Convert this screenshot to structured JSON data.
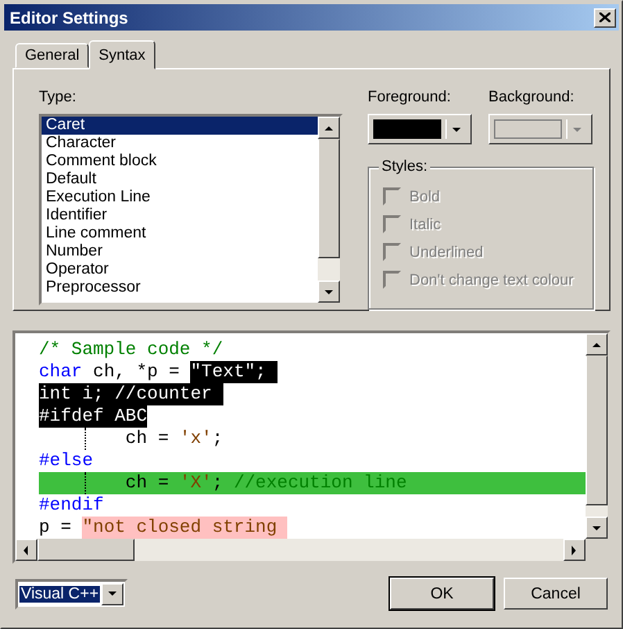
{
  "window": {
    "title": "Editor Settings"
  },
  "tabs": [
    {
      "label": "General",
      "selected": false
    },
    {
      "label": "Syntax",
      "selected": true
    }
  ],
  "type_list": {
    "label": "Type:",
    "items": [
      {
        "label": "Caret",
        "selected": true
      },
      {
        "label": "Character",
        "selected": false
      },
      {
        "label": "Comment block",
        "selected": false
      },
      {
        "label": "Default",
        "selected": false
      },
      {
        "label": "Execution Line",
        "selected": false
      },
      {
        "label": "Identifier",
        "selected": false
      },
      {
        "label": "Line comment",
        "selected": false
      },
      {
        "label": "Number",
        "selected": false
      },
      {
        "label": "Operator",
        "selected": false
      },
      {
        "label": "Preprocessor",
        "selected": false
      }
    ]
  },
  "foreground": {
    "label": "Foreground:",
    "color": "#000000",
    "disabled": false
  },
  "background": {
    "label": "Background:",
    "disabled": true
  },
  "styles": {
    "label": "Styles:",
    "options": [
      {
        "label": "Bold",
        "checked": false,
        "disabled": true
      },
      {
        "label": "Italic",
        "checked": false,
        "disabled": true
      },
      {
        "label": "Underlined",
        "checked": false,
        "disabled": true
      },
      {
        "label": "Don't change text colour",
        "checked": false,
        "disabled": true
      }
    ]
  },
  "code_lines": [
    {
      "kind": "normal",
      "indent_guide": false,
      "segments": [
        {
          "text": "/* Sample code */",
          "kind": "comment",
          "selected": false
        }
      ]
    },
    {
      "kind": "normal",
      "indent_guide": false,
      "segments": [
        {
          "text": "char",
          "kind": "keyword",
          "selected": false
        },
        {
          "text": " ch, *p = ",
          "kind": "plain",
          "selected": false
        },
        {
          "text": "\"Text\"; ",
          "kind": "plain",
          "selected": true
        }
      ]
    },
    {
      "kind": "normal",
      "indent_guide": false,
      "segments": [
        {
          "text": "int i; //counter ",
          "kind": "plain",
          "selected": true
        }
      ]
    },
    {
      "kind": "normal",
      "indent_guide": false,
      "segments": [
        {
          "text": "#ifdef ABC",
          "kind": "plain",
          "selected": true
        }
      ]
    },
    {
      "kind": "normal",
      "indent_guide": true,
      "segments": [
        {
          "text": "        ch = ",
          "kind": "plain",
          "selected": false
        },
        {
          "text": "'x'",
          "kind": "char",
          "selected": false
        },
        {
          "text": ";",
          "kind": "plain",
          "selected": false
        }
      ]
    },
    {
      "kind": "normal",
      "indent_guide": false,
      "segments": [
        {
          "text": "#else",
          "kind": "preproc",
          "selected": false
        }
      ]
    },
    {
      "kind": "execution",
      "indent_guide": true,
      "segments": [
        {
          "text": "        ch = ",
          "kind": "plain",
          "selected": false
        },
        {
          "text": "'X'",
          "kind": "char",
          "selected": false
        },
        {
          "text": "; ",
          "kind": "plain",
          "selected": false
        },
        {
          "text": "//execution line",
          "kind": "comment",
          "selected": false
        }
      ]
    },
    {
      "kind": "normal",
      "indent_guide": false,
      "segments": [
        {
          "text": "#endif",
          "kind": "preproc",
          "selected": false
        }
      ]
    },
    {
      "kind": "normal",
      "indent_guide": false,
      "segments": [
        {
          "text": "p = ",
          "kind": "plain",
          "selected": false
        },
        {
          "text": "\"not closed string ",
          "kind": "unclosed",
          "selected": false
        }
      ]
    }
  ],
  "language": {
    "value": "Visual C++"
  },
  "buttons": [
    {
      "label": "OK",
      "default": true
    },
    {
      "label": "Cancel",
      "default": false
    }
  ]
}
